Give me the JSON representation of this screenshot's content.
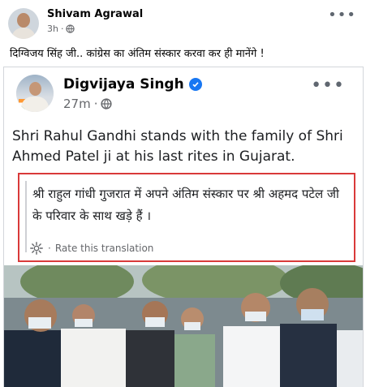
{
  "outer_post": {
    "author": "Shivam Agrawal",
    "time": "3h",
    "text": "दिग्विजय सिंह जी.. कांग्रेस का अंतिम संस्कार करवा कर ही मानेंगे !",
    "menu": "•••"
  },
  "inner_post": {
    "author": "Digvijaya Singh",
    "time": "27m",
    "text": "Shri Rahul Gandhi  stands with the family of Shri Ahmed Patel ji at his last rites in Gujarat.",
    "menu": "•••",
    "translation": "श्री राहुल गांधी गुजरात में अपने अंतिम संस्कार पर श्री अहमद पटेल जी के परिवार के साथ खड़े हैं ।",
    "rate_translation": "Rate this translation"
  },
  "icons": {
    "globe": "globe-icon",
    "verified": "verified-badge-icon",
    "settings": "gear-icon",
    "more": "more-options-icon"
  },
  "colors": {
    "highlight_border": "#d93a3a",
    "verified": "#1877f2"
  }
}
